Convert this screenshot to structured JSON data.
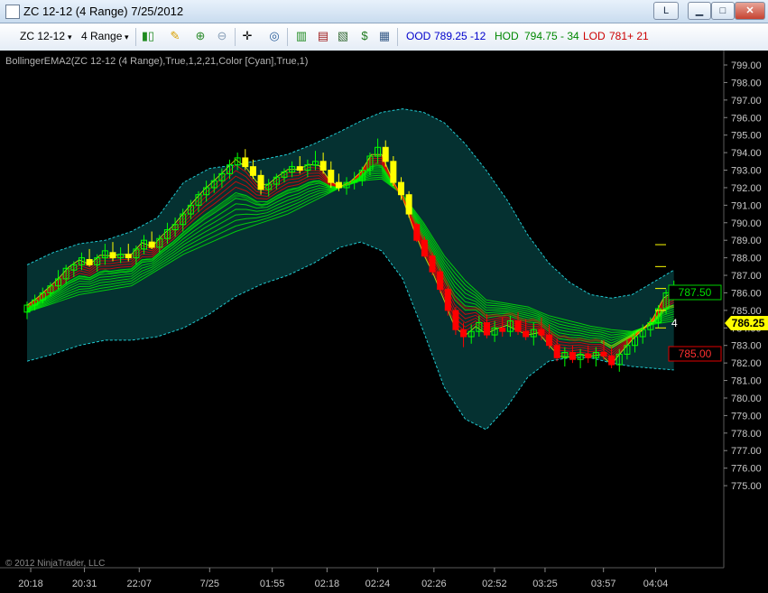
{
  "window": {
    "title": "ZC 12-12 (4 Range)  7/25/2012",
    "buttons": {
      "l": "L",
      "minimize": "▁",
      "maximize": "□",
      "close": "✕"
    }
  },
  "toolbar": {
    "instrument": "ZC 12-12",
    "period": "4 Range",
    "ood_label": "OOD",
    "ood_value": "789.25",
    "ood_change": "-12",
    "hod_label": "HOD",
    "hod_value": "794.75",
    "hod_change": "- 34",
    "lod_label": "LOD",
    "lod_value": "781",
    "lod_change": "+ 21",
    "icons": [
      "bar-type-icon",
      "draw-icon",
      "zoom-in-icon",
      "zoom-out-icon",
      "crosshair-icon",
      "magnifier-icon",
      "indicators-icon",
      "strategies-icon",
      "properties-icon",
      "dollar-icon",
      "data-box-icon"
    ]
  },
  "indicator_label": "BollingerEMA2(ZC 12-12 (4 Range),True,1,2,21,Color [Cyan],True,1)",
  "copyright": "© 2012 NinjaTrader, LLC",
  "price_flags": {
    "upper": "787.50",
    "lower": "785.00",
    "current": "786.25",
    "count": "4"
  },
  "colors": {
    "band_fill": "#063a3a",
    "band_line": "#20c8d0",
    "bullish": "#00ff00",
    "yellow": "#ffff00",
    "bearish": "#ff0000",
    "axis_text": "#c8c8c8"
  },
  "chart_data": {
    "type": "candlestick",
    "y_ticks": [
      "799.00",
      "798.00",
      "797.00",
      "796.00",
      "795.00",
      "794.00",
      "793.00",
      "792.00",
      "791.00",
      "790.00",
      "789.00",
      "788.00",
      "787.00",
      "786.00",
      "785.00",
      "784.00",
      "783.00",
      "782.00",
      "781.00",
      "780.00",
      "779.00",
      "778.00",
      "777.00",
      "776.00",
      "775.00"
    ],
    "ylim": [
      774.5,
      799.5
    ],
    "x_ticks": [
      "20:18",
      "20:31",
      "22:07",
      "7/25",
      "01:55",
      "02:18",
      "02:24",
      "02:26",
      "02:52",
      "03:25",
      "03:57",
      "04:04"
    ],
    "series": [
      {
        "name": "Upper band",
        "values": [
          [
            0,
            787.6
          ],
          [
            5,
            788.3
          ],
          [
            10,
            788.8
          ],
          [
            15,
            789.0
          ],
          [
            20,
            789.5
          ],
          [
            25,
            790.3
          ],
          [
            30,
            792.3
          ],
          [
            35,
            793.1
          ],
          [
            40,
            793.3
          ],
          [
            45,
            793.6
          ],
          [
            50,
            793.9
          ],
          [
            55,
            794.5
          ],
          [
            60,
            795.2
          ],
          [
            64,
            795.8
          ],
          [
            68,
            796.3
          ],
          [
            72,
            796.5
          ],
          [
            76,
            796.3
          ],
          [
            80,
            795.7
          ],
          [
            84,
            794.5
          ],
          [
            88,
            793.0
          ],
          [
            92,
            791.3
          ],
          [
            96,
            789.3
          ],
          [
            100,
            787.7
          ],
          [
            104,
            786.6
          ],
          [
            108,
            785.9
          ],
          [
            112,
            785.7
          ],
          [
            116,
            785.9
          ],
          [
            120,
            786.6
          ],
          [
            124,
            787.3
          ]
        ]
      },
      {
        "name": "Lower band",
        "values": [
          [
            0,
            782.1
          ],
          [
            5,
            782.5
          ],
          [
            10,
            783.0
          ],
          [
            15,
            783.3
          ],
          [
            20,
            783.3
          ],
          [
            25,
            783.5
          ],
          [
            30,
            784.0
          ],
          [
            35,
            784.8
          ],
          [
            40,
            785.8
          ],
          [
            45,
            786.5
          ],
          [
            50,
            787.0
          ],
          [
            55,
            787.7
          ],
          [
            60,
            788.6
          ],
          [
            64,
            788.9
          ],
          [
            68,
            788.4
          ],
          [
            72,
            786.8
          ],
          [
            76,
            783.8
          ],
          [
            80,
            780.6
          ],
          [
            84,
            778.8
          ],
          [
            88,
            778.2
          ],
          [
            92,
            779.5
          ],
          [
            96,
            781.2
          ],
          [
            100,
            782.1
          ],
          [
            104,
            782.3
          ],
          [
            108,
            782.3
          ],
          [
            112,
            782.0
          ],
          [
            116,
            781.8
          ],
          [
            120,
            781.7
          ],
          [
            124,
            781.6
          ]
        ]
      },
      {
        "name": "Mid band",
        "values": [
          [
            0,
            784.9
          ],
          [
            10,
            785.9
          ],
          [
            20,
            786.4
          ],
          [
            30,
            788.2
          ],
          [
            40,
            789.5
          ],
          [
            50,
            790.5
          ],
          [
            60,
            792.0
          ],
          [
            64,
            792.4
          ],
          [
            68,
            792.5
          ],
          [
            72,
            791.6
          ],
          [
            76,
            790.0
          ],
          [
            80,
            788.1
          ],
          [
            84,
            786.7
          ],
          [
            88,
            785.6
          ],
          [
            92,
            785.4
          ],
          [
            96,
            785.2
          ],
          [
            100,
            784.7
          ],
          [
            104,
            784.4
          ],
          [
            108,
            784.1
          ],
          [
            112,
            783.9
          ],
          [
            116,
            783.8
          ],
          [
            120,
            784.2
          ],
          [
            124,
            784.4
          ]
        ]
      }
    ],
    "candles": [
      [
        0,
        784.9,
        785.5,
        784.5,
        785.3
      ],
      [
        1,
        785.3,
        785.9,
        785.0,
        785.6
      ],
      [
        2,
        785.6,
        786.3,
        785.4,
        786.0
      ],
      [
        3,
        786.0,
        786.6,
        785.8,
        786.4
      ],
      [
        4,
        786.4,
        787.3,
        786.2,
        786.8
      ],
      [
        5,
        786.8,
        787.6,
        786.5,
        787.4
      ],
      [
        6,
        787.3,
        787.8,
        786.9,
        787.6
      ],
      [
        7,
        787.6,
        788.3,
        787.3,
        788.0
      ],
      [
        8,
        787.9,
        788.5,
        787.5,
        787.6
      ],
      [
        9,
        787.6,
        788.2,
        787.2,
        788.0
      ],
      [
        10,
        788.0,
        788.8,
        787.6,
        788.4
      ],
      [
        11,
        788.3,
        788.9,
        787.8,
        788.0
      ],
      [
        12,
        788.0,
        788.6,
        787.7,
        788.2
      ],
      [
        13,
        788.2,
        788.8,
        787.8,
        788.0
      ],
      [
        14,
        788.0,
        788.7,
        787.6,
        788.5
      ],
      [
        15,
        788.5,
        789.3,
        788.2,
        789.0
      ],
      [
        16,
        788.9,
        789.5,
        788.5,
        788.6
      ],
      [
        17,
        788.6,
        789.3,
        788.3,
        789.1
      ],
      [
        18,
        789.1,
        790.0,
        788.8,
        789.6
      ],
      [
        19,
        789.6,
        790.3,
        789.2,
        789.9
      ],
      [
        20,
        789.9,
        790.8,
        789.5,
        790.5
      ],
      [
        21,
        790.5,
        791.3,
        790.2,
        791.0
      ],
      [
        22,
        791.0,
        791.8,
        790.6,
        791.6
      ],
      [
        23,
        791.6,
        792.4,
        791.2,
        792.0
      ],
      [
        24,
        792.0,
        792.8,
        791.7,
        792.4
      ],
      [
        25,
        792.4,
        793.1,
        792.0,
        792.8
      ],
      [
        26,
        792.8,
        793.6,
        792.5,
        793.3
      ],
      [
        27,
        793.3,
        794.0,
        793.0,
        793.7
      ],
      [
        28,
        793.7,
        794.2,
        793.0,
        793.2
      ],
      [
        29,
        793.2,
        793.6,
        792.5,
        792.7
      ],
      [
        30,
        792.7,
        793.0,
        791.6,
        791.9
      ],
      [
        31,
        791.9,
        792.5,
        791.5,
        792.2
      ],
      [
        32,
        792.2,
        792.8,
        791.9,
        792.6
      ],
      [
        33,
        792.6,
        793.1,
        792.3,
        792.9
      ],
      [
        34,
        792.9,
        793.5,
        792.6,
        793.2
      ],
      [
        35,
        793.2,
        793.8,
        792.8,
        793.0
      ],
      [
        36,
        793.0,
        793.6,
        792.6,
        793.3
      ],
      [
        37,
        793.3,
        794.1,
        793.0,
        793.5
      ],
      [
        38,
        793.5,
        794.0,
        792.8,
        793.0
      ],
      [
        39,
        793.0,
        793.5,
        792.0,
        792.3
      ],
      [
        40,
        792.3,
        792.8,
        791.8,
        792.0
      ],
      [
        41,
        792.0,
        792.6,
        791.6,
        792.3
      ],
      [
        42,
        792.3,
        792.9,
        791.9,
        792.4
      ],
      [
        43,
        792.4,
        793.2,
        792.1,
        793.0
      ],
      [
        44,
        793.0,
        794.0,
        792.7,
        793.8
      ],
      [
        45,
        793.8,
        794.8,
        793.4,
        794.3
      ],
      [
        46,
        794.3,
        794.7,
        793.2,
        793.5
      ],
      [
        47,
        793.5,
        793.8,
        792.1,
        792.3
      ],
      [
        48,
        792.3,
        792.6,
        791.3,
        791.6
      ],
      [
        49,
        791.6,
        791.8,
        790.3,
        790.5
      ],
      [
        50,
        789.9,
        790.0,
        788.9,
        789.0
      ],
      [
        51,
        789.0,
        789.2,
        788.0,
        788.1
      ],
      [
        52,
        788.1,
        788.3,
        787.0,
        787.2
      ],
      [
        53,
        787.2,
        787.4,
        786.0,
        786.2
      ],
      [
        54,
        786.2,
        786.4,
        784.7,
        785.0
      ],
      [
        55,
        785.0,
        785.2,
        783.6,
        783.9
      ],
      [
        56,
        783.9,
        784.3,
        782.9,
        783.5
      ],
      [
        57,
        783.5,
        784.2,
        783.1,
        783.8
      ],
      [
        58,
        783.8,
        784.7,
        783.5,
        784.3
      ],
      [
        59,
        784.3,
        784.8,
        783.4,
        783.6
      ],
      [
        60,
        783.6,
        784.4,
        783.2,
        784.0
      ],
      [
        61,
        784.0,
        784.6,
        783.5,
        783.8
      ],
      [
        62,
        783.8,
        784.7,
        783.5,
        784.4
      ],
      [
        63,
        784.4,
        784.9,
        783.6,
        783.8
      ],
      [
        64,
        783.8,
        784.5,
        783.3,
        783.5
      ],
      [
        65,
        783.5,
        784.3,
        783.0,
        783.9
      ],
      [
        66,
        783.9,
        784.6,
        783.3,
        783.6
      ],
      [
        67,
        783.6,
        784.2,
        782.8,
        783.0
      ],
      [
        68,
        783.0,
        783.4,
        782.1,
        782.3
      ],
      [
        69,
        782.3,
        782.9,
        781.8,
        782.6
      ],
      [
        70,
        782.6,
        783.0,
        782.0,
        782.2
      ],
      [
        71,
        782.2,
        782.8,
        781.7,
        782.5
      ],
      [
        72,
        782.5,
        783.0,
        782.0,
        782.3
      ],
      [
        73,
        782.3,
        782.9,
        781.8,
        782.6
      ],
      [
        74,
        782.6,
        783.3,
        782.2,
        782.4
      ],
      [
        75,
        782.4,
        782.9,
        781.7,
        781.9
      ],
      [
        76,
        781.9,
        782.8,
        781.5,
        782.5
      ],
      [
        77,
        782.5,
        783.3,
        782.2,
        783.0
      ],
      [
        78,
        783.0,
        783.8,
        782.6,
        783.5
      ],
      [
        79,
        783.5,
        784.2,
        783.1,
        783.9
      ],
      [
        80,
        783.9,
        784.6,
        783.5,
        784.3
      ],
      [
        81,
        784.3,
        785.3,
        784.0,
        785.1
      ],
      [
        82,
        785.1,
        786.2,
        784.8,
        786.0
      ],
      [
        83,
        786.0,
        786.7,
        785.6,
        786.1
      ]
    ],
    "legend": "none",
    "grid": false
  }
}
